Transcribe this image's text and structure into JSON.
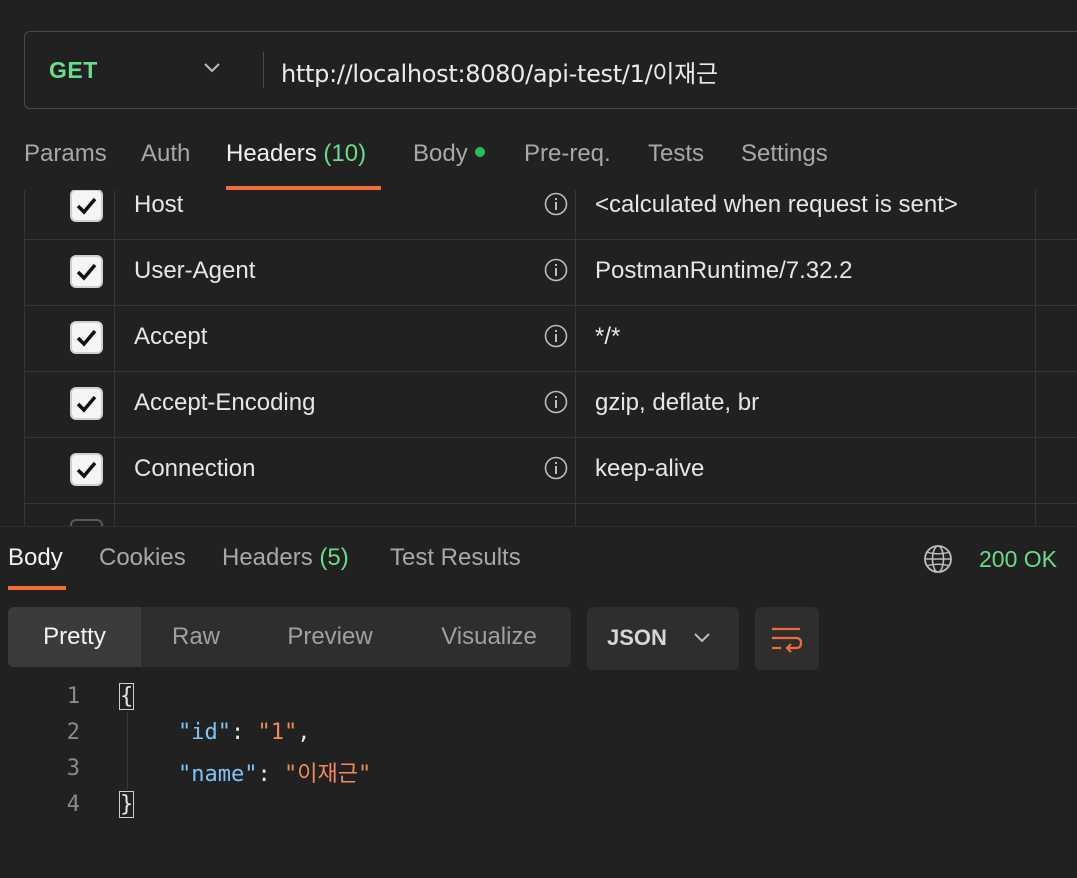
{
  "request": {
    "method": "GET",
    "url": "http://localhost:8080/api-test/1/이재근"
  },
  "request_tabs": [
    {
      "label": "Params"
    },
    {
      "label": "Auth"
    },
    {
      "label": "Headers",
      "count": "(10)",
      "active": true
    },
    {
      "label": "Body",
      "dot": true
    },
    {
      "label": "Pre-req."
    },
    {
      "label": "Tests"
    },
    {
      "label": "Settings"
    }
  ],
  "headers": [
    {
      "key": "Host",
      "value": "<calculated when request is sent>",
      "checked": true
    },
    {
      "key": "User-Agent",
      "value": "PostmanRuntime/7.32.2",
      "checked": true
    },
    {
      "key": "Accept",
      "value": "*/*",
      "checked": true
    },
    {
      "key": "Accept-Encoding",
      "value": "gzip, deflate, br",
      "checked": true
    },
    {
      "key": "Connection",
      "value": "keep-alive",
      "checked": true
    }
  ],
  "response_tabs": [
    {
      "label": "Body",
      "active": true
    },
    {
      "label": "Cookies"
    },
    {
      "label": "Headers",
      "count": "(5)"
    },
    {
      "label": "Test Results"
    }
  ],
  "status": "200 OK",
  "view_modes": [
    "Pretty",
    "Raw",
    "Preview",
    "Visualize"
  ],
  "active_view_mode": "Pretty",
  "format": "JSON",
  "code_lines": [
    {
      "num": "1",
      "open": "{"
    },
    {
      "num": "2",
      "key": "\"id\"",
      "sep": ": ",
      "val": "\"1\"",
      "tail": ","
    },
    {
      "num": "3",
      "key": "\"name\"",
      "sep": ": ",
      "val": "\"이재근\"",
      "tail": ""
    },
    {
      "num": "4",
      "close": "}"
    }
  ],
  "colors": {
    "accent": "#f26b3a",
    "success": "#6bdd8a",
    "json_key": "#7fc4f5",
    "json_string": "#f08a5d"
  },
  "icons": {
    "method_dropdown": "chevron-down-icon",
    "info": "info-icon",
    "checkbox": "check-icon",
    "network": "globe-icon",
    "format_dropdown": "chevron-down-icon",
    "wrap": "text-wrap-icon"
  }
}
